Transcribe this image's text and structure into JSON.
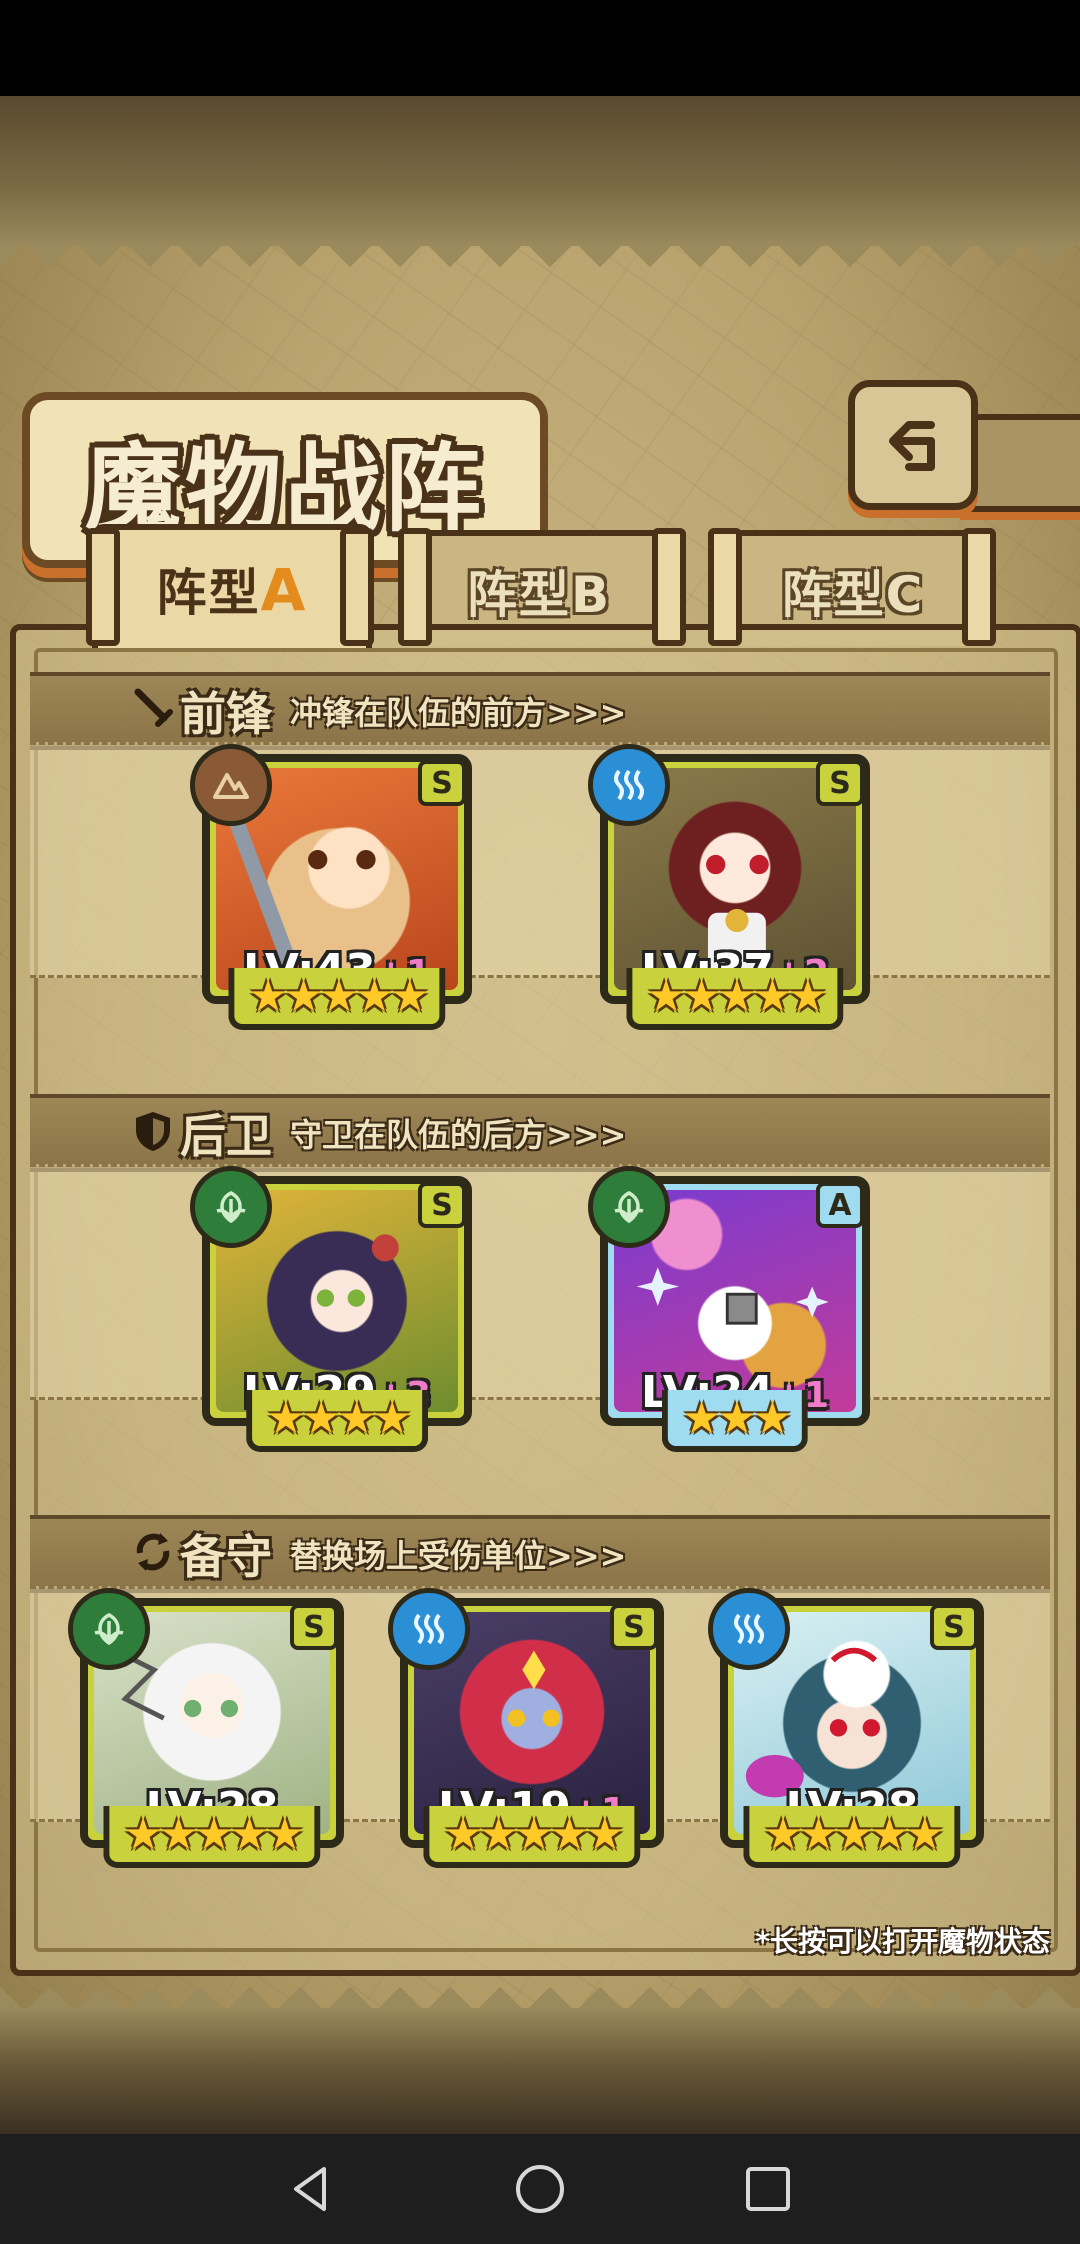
{
  "title": "魔物战阵",
  "tabs": [
    {
      "prefix": "阵型",
      "letter": "A",
      "active": true
    },
    {
      "prefix": "阵型",
      "letter": "B",
      "active": false
    },
    {
      "prefix": "阵型",
      "letter": "C",
      "active": false
    }
  ],
  "sections": {
    "front": {
      "name": "前锋",
      "desc": "冲锋在队伍的前方>>>",
      "icon": "sword-icon"
    },
    "back": {
      "name": "后卫",
      "desc": "守卫在队伍的后方>>>",
      "icon": "shield-icon"
    },
    "reserve": {
      "name": "备守",
      "desc": "替换场上受伤单位>>>",
      "icon": "swap-icon"
    }
  },
  "cards": {
    "front1": {
      "element": "earth-icon",
      "rank": "S",
      "lv": "LV:43",
      "plus": "+1",
      "stars": "★★★★★"
    },
    "front2": {
      "element": "water-icon",
      "rank": "S",
      "lv": "LV:37",
      "plus": "+2",
      "stars": "★★★★★"
    },
    "back1": {
      "element": "leaf-icon",
      "rank": "S",
      "lv": "LV:29",
      "plus": "+3",
      "stars": "★★★★"
    },
    "back2": {
      "element": "leaf-icon",
      "rank": "A",
      "lv": "LV:24",
      "plus": "+1",
      "stars": "★★★"
    },
    "res1": {
      "element": "leaf-icon",
      "rank": "S",
      "lv": "LV:28",
      "plus": "",
      "stars": "★★★★★"
    },
    "res2": {
      "element": "water-icon",
      "rank": "S",
      "lv": "LV:19",
      "plus": "+1",
      "stars": "★★★★★"
    },
    "res3": {
      "element": "water-icon",
      "rank": "S",
      "lv": "LV:28",
      "plus": "",
      "stars": "★★★★★"
    }
  },
  "hint": "*长按可以打开魔物状态",
  "colors": {
    "frame_gold": "#c9d23c",
    "frame_blue": "#9fdcf0",
    "outline": "#2e2a1a",
    "accent_orange": "#e38b1c"
  }
}
